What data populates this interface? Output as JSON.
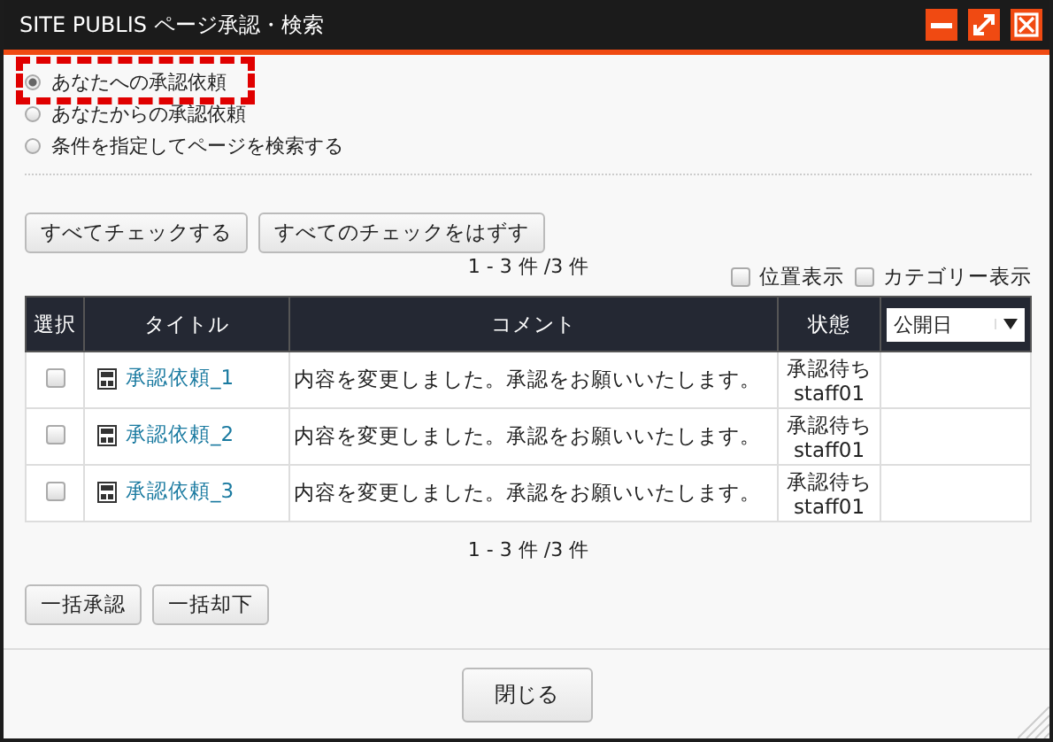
{
  "window": {
    "title": "SITE PUBLIS ページ承認・検索",
    "controls": [
      {
        "kind": "minimize"
      },
      {
        "kind": "maximize"
      },
      {
        "kind": "close"
      }
    ]
  },
  "modes": [
    {
      "label": "あなたへの承認依頼",
      "selected": true,
      "highlighted": true
    },
    {
      "label": "あなたからの承認依頼",
      "selected": false,
      "highlighted": false
    },
    {
      "label": "条件を指定してページを検索する",
      "selected": false,
      "highlighted": false
    }
  ],
  "check_buttons": [
    "すべてチェックする",
    "すべてのチェックをはずす"
  ],
  "count_top": "1 - 3 件 /3 件",
  "view_options": [
    {
      "label": "位置表示",
      "checked": false
    },
    {
      "label": "カテゴリー表示",
      "checked": false
    }
  ],
  "table": {
    "columns": [
      "選択",
      "タイトル",
      "コメント",
      "状態"
    ],
    "sort_select": {
      "value": "公開日"
    },
    "rows": [
      {
        "checked": false,
        "title": "承認依頼_1",
        "comment": "内容を変更しました。承認をお願いいたします。",
        "status": "承認待ち",
        "user": "staff01"
      },
      {
        "checked": false,
        "title": "承認依頼_2",
        "comment": "内容を変更しました。承認をお願いいたします。",
        "status": "承認待ち",
        "user": "staff01"
      },
      {
        "checked": false,
        "title": "承認依頼_3",
        "comment": "内容を変更しました。承認をお願いいたします。",
        "status": "承認待ち",
        "user": "staff01"
      }
    ]
  },
  "count_bottom": "1 - 3 件 /3 件",
  "bulk_buttons": [
    "一括承認",
    "一括却下"
  ],
  "footer_button": "閉じる"
}
